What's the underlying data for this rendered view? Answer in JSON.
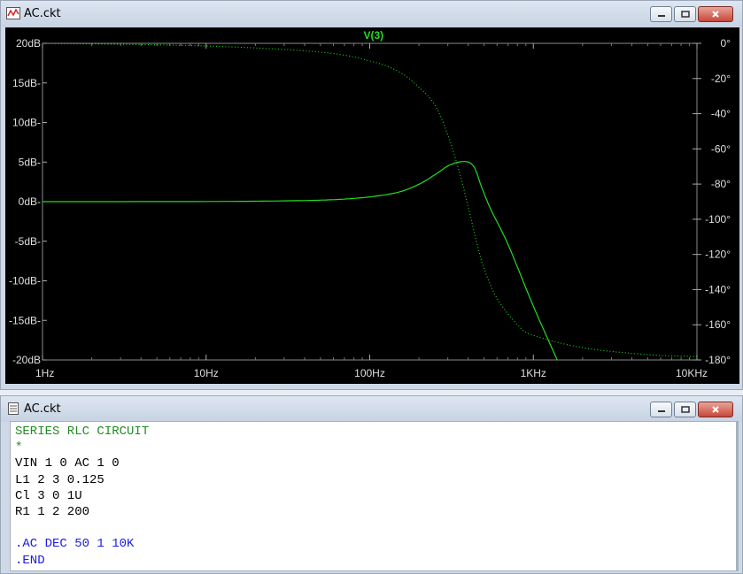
{
  "plot_window": {
    "title": "AC.ckt",
    "trace_label": "V(3)",
    "trace_color": "#22dd22"
  },
  "netlist_window": {
    "title": "AC.ckt",
    "lines": [
      {
        "text": "SERIES RLC CIRCUIT",
        "color": "green"
      },
      {
        "text": "*",
        "color": "green"
      },
      {
        "text": "VIN 1 0 AC 1 0",
        "color": "black"
      },
      {
        "text": "L1 2 3 0.125",
        "color": "black"
      },
      {
        "text": "Cl 3 0 1U",
        "color": "black"
      },
      {
        "text": "R1 1 2 200",
        "color": "black"
      },
      {
        "text": "",
        "color": "black"
      },
      {
        "text": ".AC DEC 50 1 10K",
        "color": "blue"
      },
      {
        "text": ".END",
        "color": "blue"
      }
    ]
  },
  "chart_data": {
    "type": "line",
    "title": "V(3)",
    "x_scale": "log",
    "xlim": [
      1,
      10000
    ],
    "x_ticks": [
      "1Hz",
      "10Hz",
      "100Hz",
      "1KHz",
      "10KHz"
    ],
    "y_left_ticks": [
      "20dB",
      "15dB-",
      "10dB-",
      "5dB-",
      "0dB-",
      "-5dB-",
      "-10dB-",
      "-15dB-",
      "-20dB"
    ],
    "y_left_lim": [
      -20,
      20
    ],
    "y_right_ticks": [
      "0°",
      "-20°",
      "-40°",
      "-60°",
      "-80°",
      "-100°",
      "-120°",
      "-140°",
      "-160°",
      "-180°"
    ],
    "y_right_lim": [
      -180,
      0
    ],
    "series": [
      {
        "axis": "left",
        "style": "solid",
        "x": [
          1,
          10,
          30,
          60,
          100,
          150,
          200,
          250,
          300,
          350,
          400,
          430,
          450,
          480,
          550,
          700,
          1000,
          1400
        ],
        "y": [
          0,
          0.02,
          0.1,
          0.25,
          0.6,
          1.2,
          2.2,
          3.4,
          4.5,
          5.0,
          5.0,
          4.5,
          3.7,
          2.0,
          -1.0,
          -5.4,
          -13.2,
          -20
        ]
      },
      {
        "axis": "right",
        "style": "dotted",
        "x": [
          1,
          10,
          50,
          100,
          150,
          200,
          250,
          300,
          350,
          400,
          450,
          500,
          600,
          800,
          1000,
          2000,
          5000,
          10000
        ],
        "y": [
          0,
          -1.5,
          -5,
          -10,
          -16,
          -25,
          -35,
          -52,
          -72,
          -93,
          -113,
          -128,
          -145,
          -160,
          -166,
          -173,
          -177,
          -178
        ]
      }
    ]
  }
}
